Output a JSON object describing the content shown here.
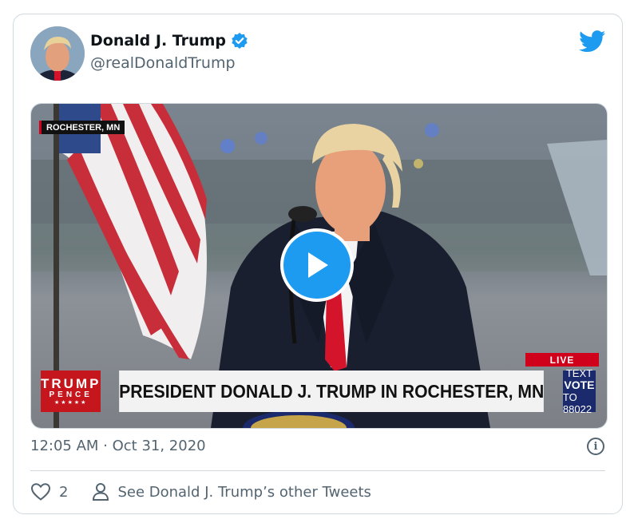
{
  "tweet": {
    "author_name": "Donald J. Trump",
    "handle": "@realDonaldTrump",
    "timestamp": "12:05 AM · Oct 31, 2020",
    "like_count": "2",
    "other_tweets_label": "See Donald J. Trump’s other Tweets"
  },
  "video": {
    "location_tag": "ROCHESTER, MN",
    "banner_left_top": "TRUMP",
    "banner_left_bottom": "PENCE",
    "banner_stars": "★★★★★",
    "headline": "PRESIDENT DONALD J. TRUMP IN ROCHESTER, MN",
    "live_label": "LIVE",
    "vote_line1": "TEXT",
    "vote_line2": "VOTE",
    "vote_line3": "TO 88022"
  },
  "colors": {
    "brand_blue": "#1d9bf0",
    "text_primary": "#0f1419",
    "text_secondary": "#536471",
    "border": "#cfd9de",
    "banner_red": "#c4161c",
    "vote_navy": "#1a2a6c"
  },
  "icons": [
    "verified-badge-icon",
    "twitter-bird-icon",
    "play-icon",
    "info-icon",
    "heart-icon",
    "person-icon"
  ]
}
